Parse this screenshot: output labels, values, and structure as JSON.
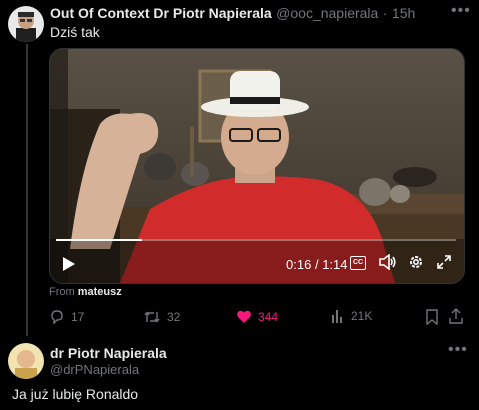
{
  "tweet": {
    "author_name": "Out Of Context Dr Piotr Napierala",
    "handle": "@ooc_napierala",
    "separator": "·",
    "time": "15h",
    "text": "Dziś tak",
    "video": {
      "time_current": "0:16",
      "time_sep": "/",
      "time_total": "1:14",
      "cc_label": "CC",
      "progress": 0.216
    },
    "from_prefix": "From",
    "from_user": "mateusz",
    "stats": {
      "replies": "17",
      "retweets": "32",
      "likes": "344",
      "views": "21K"
    },
    "like_color": "#f91880"
  },
  "reply": {
    "author_name": "dr Piotr Napierala",
    "handle": "@drPNapierala",
    "text": "Ja już lubię Ronaldo"
  }
}
